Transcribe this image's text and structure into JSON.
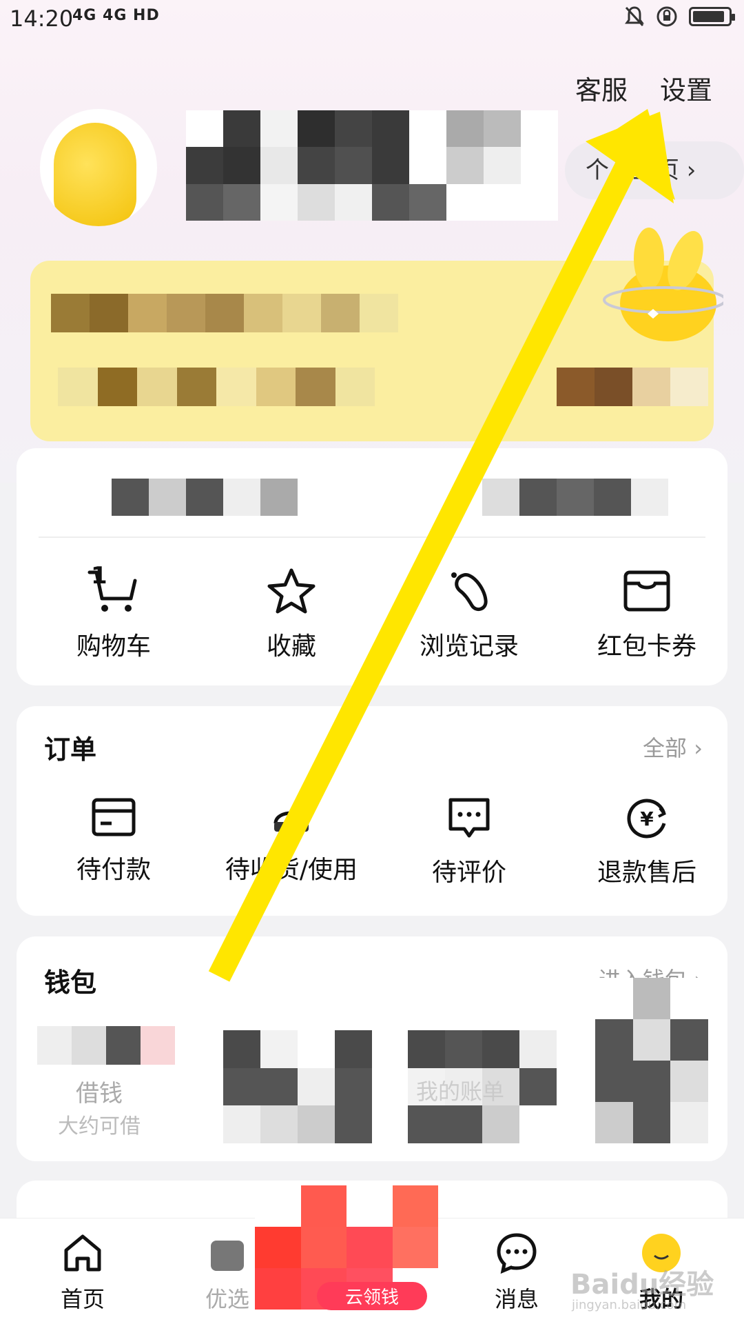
{
  "status_bar": {
    "time": "14:20",
    "network": "4G 4G HD",
    "battery_level": 0.9
  },
  "header": {
    "service_label": "客服",
    "settings_label": "设置",
    "homepage_label": "个人主页 ›"
  },
  "shortcuts": [
    {
      "label": "购物车",
      "icon": "cart-icon",
      "badge": "1"
    },
    {
      "label": "收藏",
      "icon": "star-icon"
    },
    {
      "label": "浏览记录",
      "icon": "footprint-icon"
    },
    {
      "label": "红包卡券",
      "icon": "wallet-card-icon"
    }
  ],
  "orders": {
    "title": "订单",
    "more": "全部 ›",
    "items": [
      {
        "label": "待付款",
        "icon": "card-icon"
      },
      {
        "label": "待收货/使用",
        "icon": "truck-icon"
      },
      {
        "label": "待评价",
        "icon": "comment-icon"
      },
      {
        "label": "退款售后",
        "icon": "refund-icon"
      }
    ]
  },
  "wallet": {
    "title": "钱包",
    "more": "进入钱包 ›",
    "items": [
      {
        "label": "借钱",
        "sub": "大约可借"
      },
      {
        "label": "",
        "sub": ""
      },
      {
        "label": "我的账单",
        "sub": ""
      },
      {
        "label": "",
        "sub": ""
      }
    ]
  },
  "bottom_nav": [
    {
      "label": "首页",
      "icon": "home-icon"
    },
    {
      "label": "优选",
      "icon": "bag-icon"
    },
    {
      "label": "云领钱",
      "icon": "coin-icon"
    },
    {
      "label": "消息",
      "icon": "message-icon"
    },
    {
      "label": "我的",
      "icon": "avatar-icon"
    }
  ],
  "watermark": {
    "brand": "Baidu经验",
    "url": "jingyan.baidu.com"
  },
  "colors": {
    "accent_yellow": "#FFE600",
    "member_card": "#FBEEA0",
    "promo_red": "#FF4A55"
  }
}
